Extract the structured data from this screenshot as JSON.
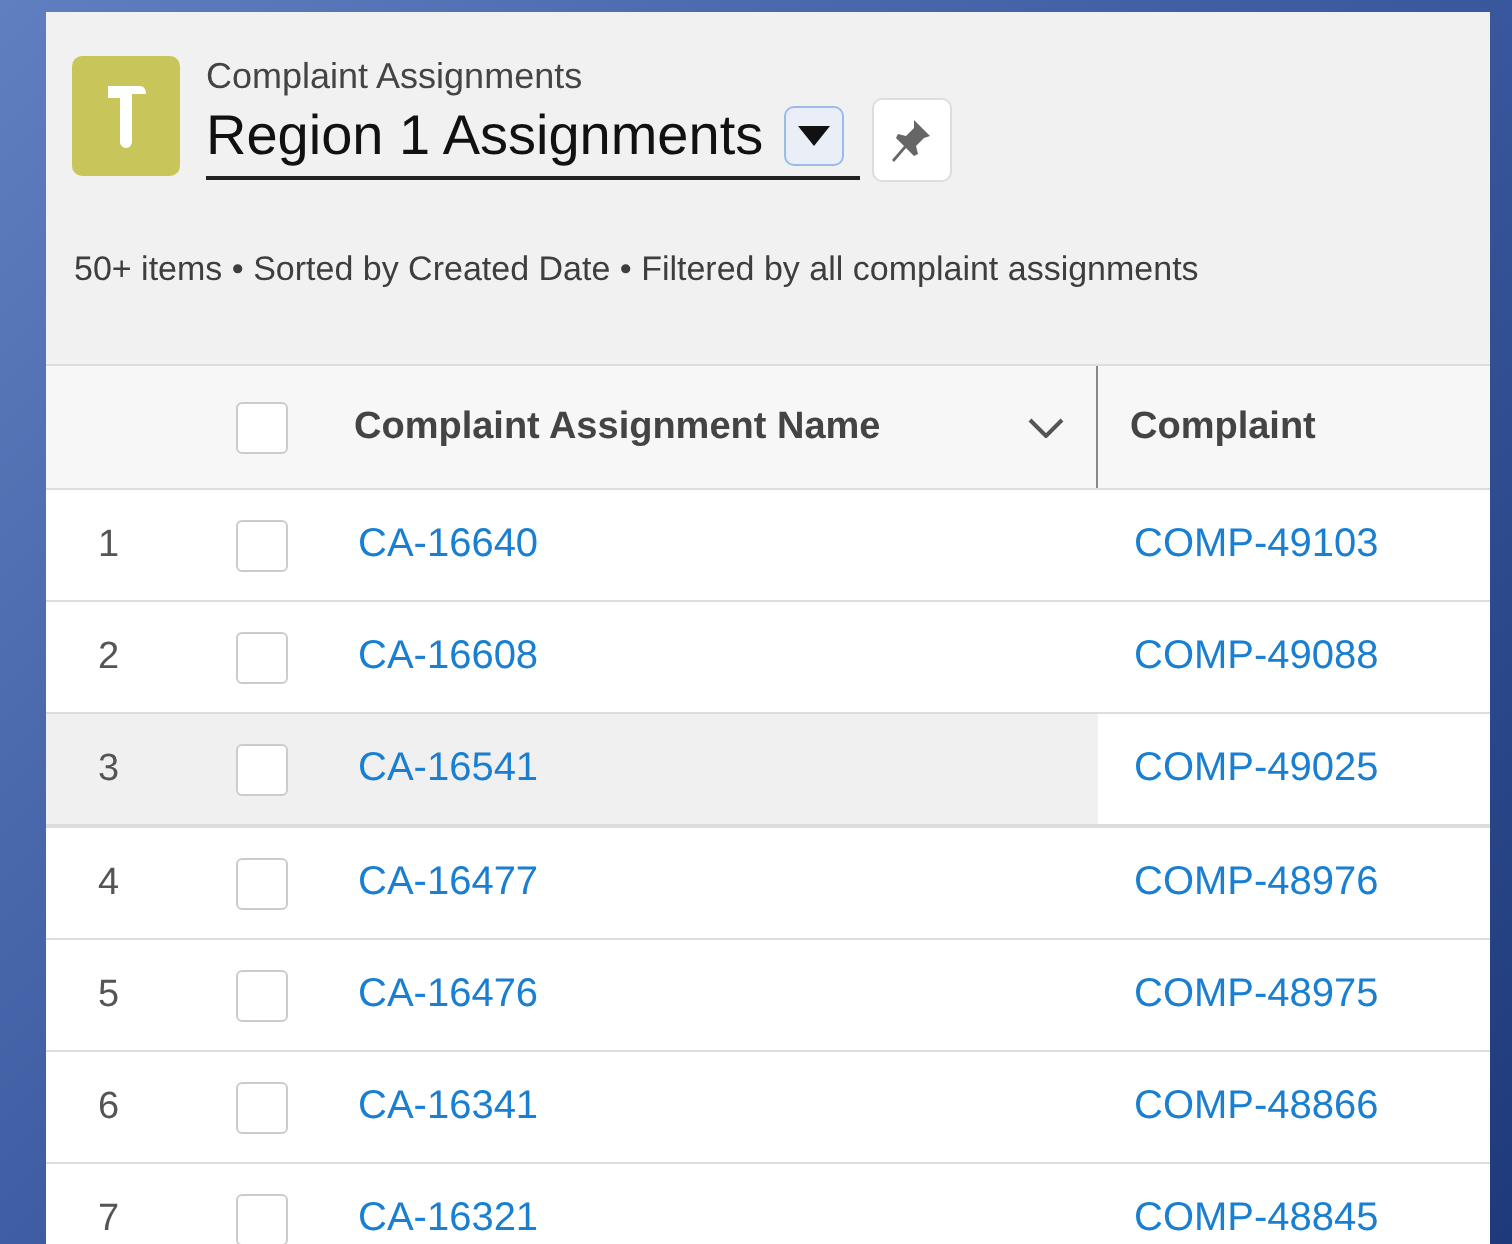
{
  "header": {
    "object_label": "Complaint Assignments",
    "list_view_name": "Region 1 Assignments",
    "summary": "50+ items • Sorted by Created Date • Filtered by all complaint assignments"
  },
  "table": {
    "select_all_checked": false,
    "columns": [
      {
        "label": "Complaint Assignment Name",
        "sortable": true
      },
      {
        "label": "Complaint",
        "sortable": false
      }
    ],
    "rows": [
      {
        "number": "1",
        "checked": false,
        "highlighted": false,
        "name": "CA-16640",
        "complaint": "COMP-49103"
      },
      {
        "number": "2",
        "checked": false,
        "highlighted": false,
        "name": "CA-16608",
        "complaint": "COMP-49088"
      },
      {
        "number": "3",
        "checked": false,
        "highlighted": true,
        "name": "CA-16541",
        "complaint": "COMP-49025"
      },
      {
        "number": "4",
        "checked": false,
        "highlighted": false,
        "name": "CA-16477",
        "complaint": "COMP-48976"
      },
      {
        "number": "5",
        "checked": false,
        "highlighted": false,
        "name": "CA-16476",
        "complaint": "COMP-48975"
      },
      {
        "number": "6",
        "checked": false,
        "highlighted": false,
        "name": "CA-16341",
        "complaint": "COMP-48866"
      },
      {
        "number": "7",
        "checked": false,
        "highlighted": false,
        "name": "CA-16321",
        "complaint": "COMP-48845"
      }
    ]
  }
}
